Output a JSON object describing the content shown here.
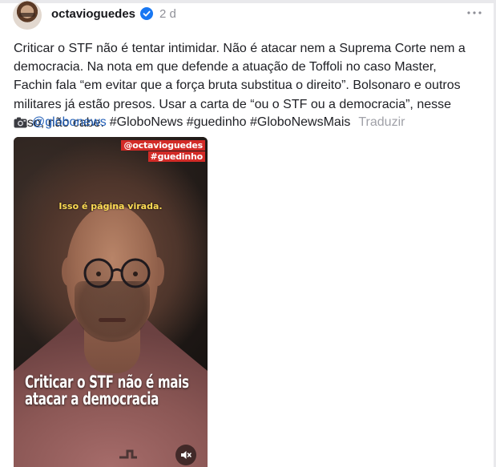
{
  "post": {
    "username": "octavioguedes",
    "timestamp": "2 d",
    "text": "Criticar o STF não é tentar intimidar. Não é atacar nem a Suprema Corte nem a democracia. Na nota em que defende a atuação de Toffoli no caso Master, Fachin fala “em evitar que a força bruta substitua o direito”. Bolsonaro e outros militares já estão presos. Usar a carta de “ou o STF ou a democracia”, nesse caso, não cabe.",
    "mention": "@globonews",
    "hashtags": "#GloboNews #guedinho #GloboNewsMais",
    "translate_label": "Traduzir"
  },
  "video": {
    "watermark_handle": "@octavioguedes",
    "watermark_tag": "#guedinho",
    "subtitle": "Isso é página virada.",
    "caption_line1": "Criticar o STF não é mais",
    "caption_line2": "atacar a democracia"
  },
  "icons": {
    "verified": "verified-badge-icon",
    "more": "more-options-icon",
    "camera": "camera-icon",
    "mute": "muted-speaker-icon"
  },
  "colors": {
    "link": "#2360b8",
    "verified": "#1877f2",
    "watermark_bg": "#d22b27",
    "subtitle": "#ffdd55"
  }
}
